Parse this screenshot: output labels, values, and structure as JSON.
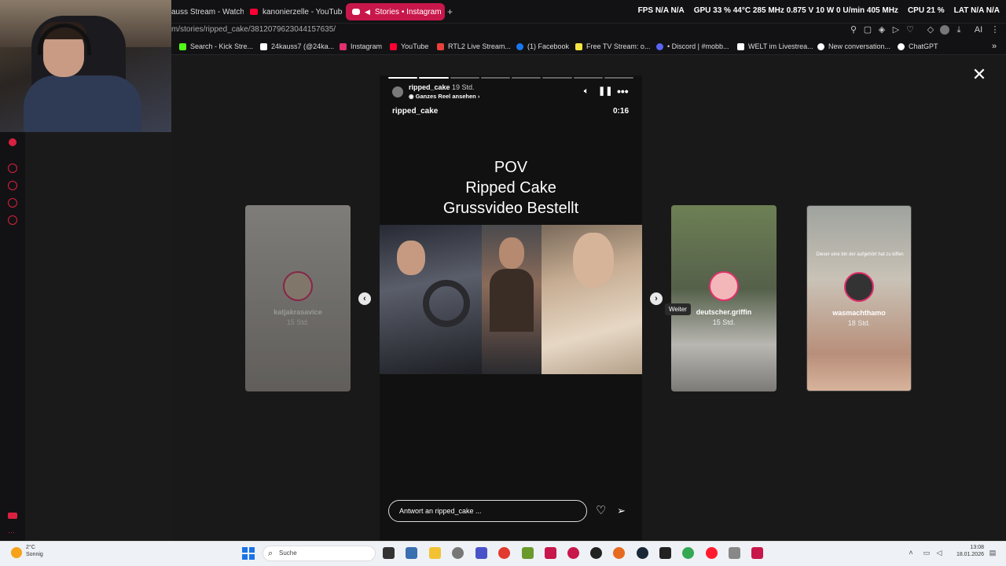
{
  "tabs": [
    {
      "label": "auss Stream - Watch L",
      "active": false
    },
    {
      "label": "kanonierzelle - YouTube",
      "active": false
    },
    {
      "label": "Stories • Instagram",
      "active": true
    }
  ],
  "new_tab_label": "+",
  "system_stats": {
    "fps": "FPS",
    "fps_val": "N/A",
    "fps_val2": "N/A",
    "gpu": "GPU",
    "gpu_val": "33 % 44°C 285 MHz 0.875 V 10 W 0 U/min 405 MHz",
    "cpu": "CPU",
    "cpu_val": "21 %",
    "lat": "LAT",
    "lat_val": "N/A",
    "lat_val2": "N/A"
  },
  "url": "m/stories/ripped_cake/3812079623044157635/",
  "bookmarks": [
    {
      "label": "Search - Kick Stre...",
      "color": "#53fc18"
    },
    {
      "label": "24kauss7 (@24ka...",
      "color": "#ffffff"
    },
    {
      "label": "Instagram",
      "color": "#e1306c"
    },
    {
      "label": "YouTube",
      "color": "#ff0033"
    },
    {
      "label": "RTL2 Live Stream...",
      "color": "#e8413a"
    },
    {
      "label": "(1) Facebook",
      "color": "#1877f2"
    },
    {
      "label": "Free TV Stream: o...",
      "color": "#f5e642"
    },
    {
      "label": "• Discord | #mobb...",
      "color": "#5865f2"
    },
    {
      "label": "WELT im Livestrea...",
      "color": "#ffffff"
    },
    {
      "label": "New conversation...",
      "color": "#ffffff"
    },
    {
      "label": "ChatGPT",
      "color": "#ffffff"
    }
  ],
  "story": {
    "username": "ripped_cake",
    "time": "19 Std.",
    "reel_link": "Ganzes Reel ansehen",
    "owner_label": "ripped_cake",
    "duration": "0:16",
    "headline_1": "POV",
    "headline_2": "Ripped Cake",
    "headline_3": "Grussvideo Bestellt",
    "progress_segments": 8,
    "progress_done": 2,
    "reply_placeholder": "Antwort an ripped_cake ..."
  },
  "side_stories": [
    {
      "username": "katjakrasavice",
      "time": "15 Std."
    },
    {
      "username": "deutscher.griffin",
      "time": "15 Std."
    },
    {
      "username": "wasmachthamo",
      "time": "18 Std.",
      "caption": "Dieser eine bin der aufgehört hat zu kiffen"
    }
  ],
  "tooltip_next": "Weiter",
  "taskbar": {
    "weather_temp": "2°C",
    "weather_desc": "Sonnig",
    "search_placeholder": "Suche",
    "time": "13:08",
    "date": "18.01.2026"
  },
  "colors": {
    "accent": "#c8174b",
    "instagram": "#e1306c"
  }
}
